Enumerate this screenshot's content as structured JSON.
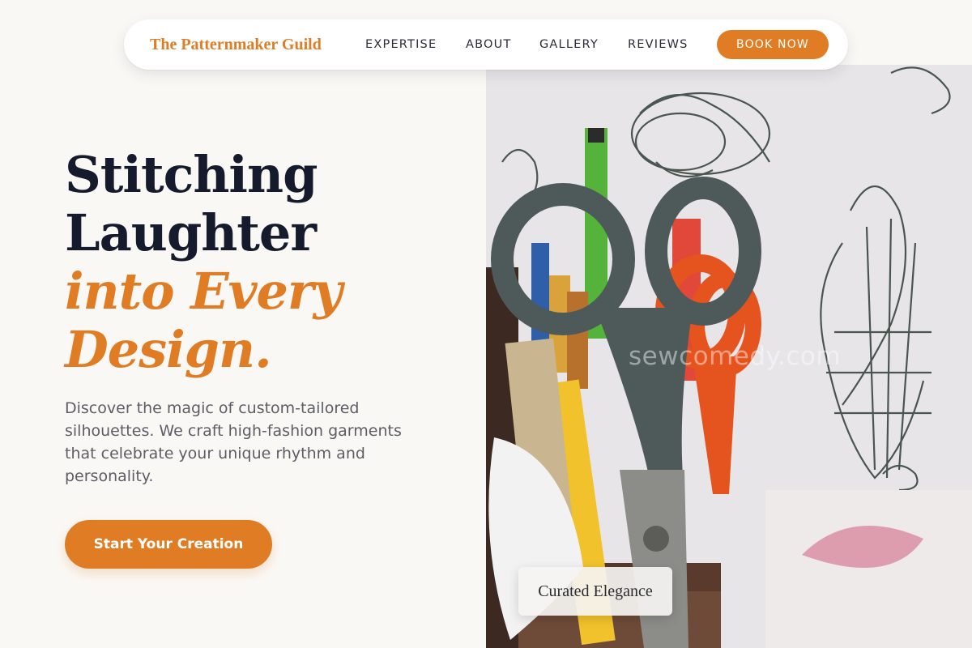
{
  "nav": {
    "brand": "The Patternmaker Guild",
    "links": [
      "EXPERTISE",
      "ABOUT",
      "GALLERY",
      "REVIEWS"
    ],
    "cta_label": "BOOK NOW"
  },
  "hero": {
    "headline_line1": "Stitching",
    "headline_line2": "Laughter",
    "headline_accent_line1": "into Every",
    "headline_accent_line2": "Design.",
    "description": "Discover the magic of custom-tailored silhouettes. We craft high-fashion garments that celebrate your unique rhythm and personality.",
    "cta_label": "Start Your Creation"
  },
  "image": {
    "watermark": "sewcomedy.com",
    "caption": "Curated Elegance"
  },
  "colors": {
    "accent": "#e07d24",
    "heading": "#151b2c",
    "background": "#faf8f5"
  }
}
